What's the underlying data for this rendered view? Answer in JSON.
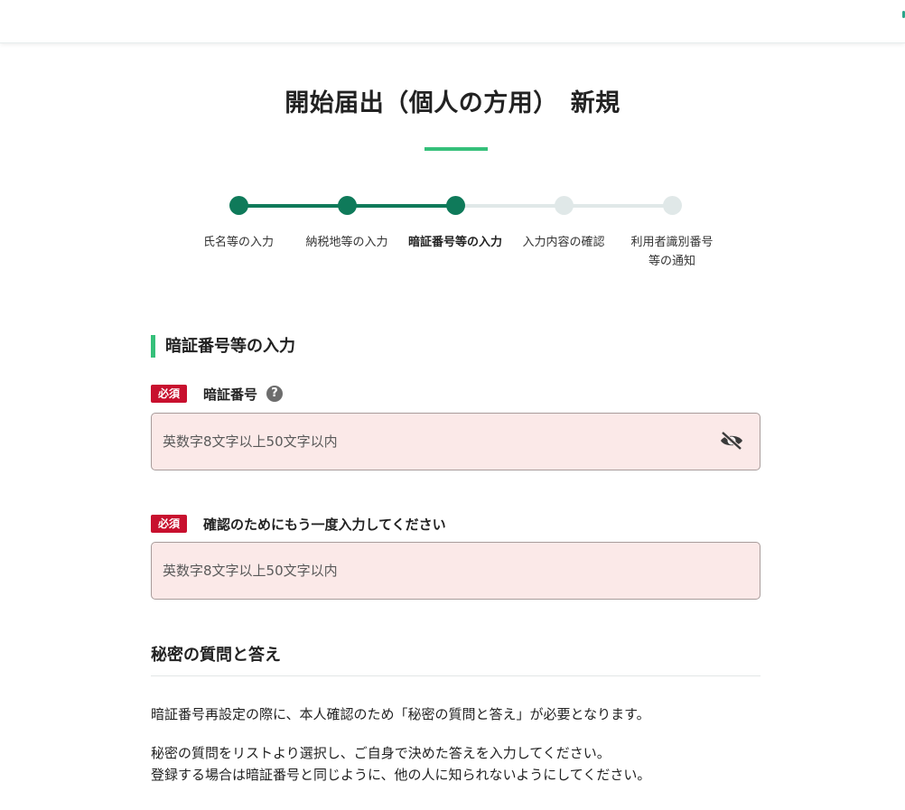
{
  "page": {
    "title": "開始届出（個人の方用）　新規"
  },
  "stepper": {
    "steps": [
      {
        "label": "氏名等の入力",
        "state": "done"
      },
      {
        "label": "納税地等の入力",
        "state": "done"
      },
      {
        "label": "暗証番号等の入力",
        "state": "current"
      },
      {
        "label": "入力内容の確認",
        "state": "todo"
      },
      {
        "label": "利用者識別番号\n等の通知",
        "label_line1": "利用者識別番号",
        "label_line2": "等の通知",
        "state": "todo"
      }
    ]
  },
  "form": {
    "section_title": "暗証番号等の入力",
    "required_badge": "必須",
    "pin": {
      "label": "暗証番号",
      "help_icon": "?",
      "placeholder": "英数字8文字以上50文字以内",
      "value": ""
    },
    "pin_confirm": {
      "label": "確認のためにもう一度入力してください",
      "placeholder": "英数字8文字以上50文字以内",
      "value": ""
    }
  },
  "secret": {
    "title": "秘密の質問と答え",
    "paragraph1": "暗証番号再設定の際に、本人確認のため「秘密の質問と答え」が必要となります。",
    "paragraph2_line1": "秘密の質問をリストより選択し、ご自身で決めた答えを入力してください。",
    "paragraph2_line2": "登録する場合は暗証番号と同じように、他の人に知られないようにしてください。"
  },
  "icons": {
    "help": "question-circle-icon",
    "password_visibility": "eye-slash-icon"
  },
  "colors": {
    "accent_green": "#35c07a",
    "step_done": "#0f7a5a",
    "step_todo": "#e0e8e8",
    "required_red": "#c8102e",
    "input_bg": "#fbe9e8"
  }
}
